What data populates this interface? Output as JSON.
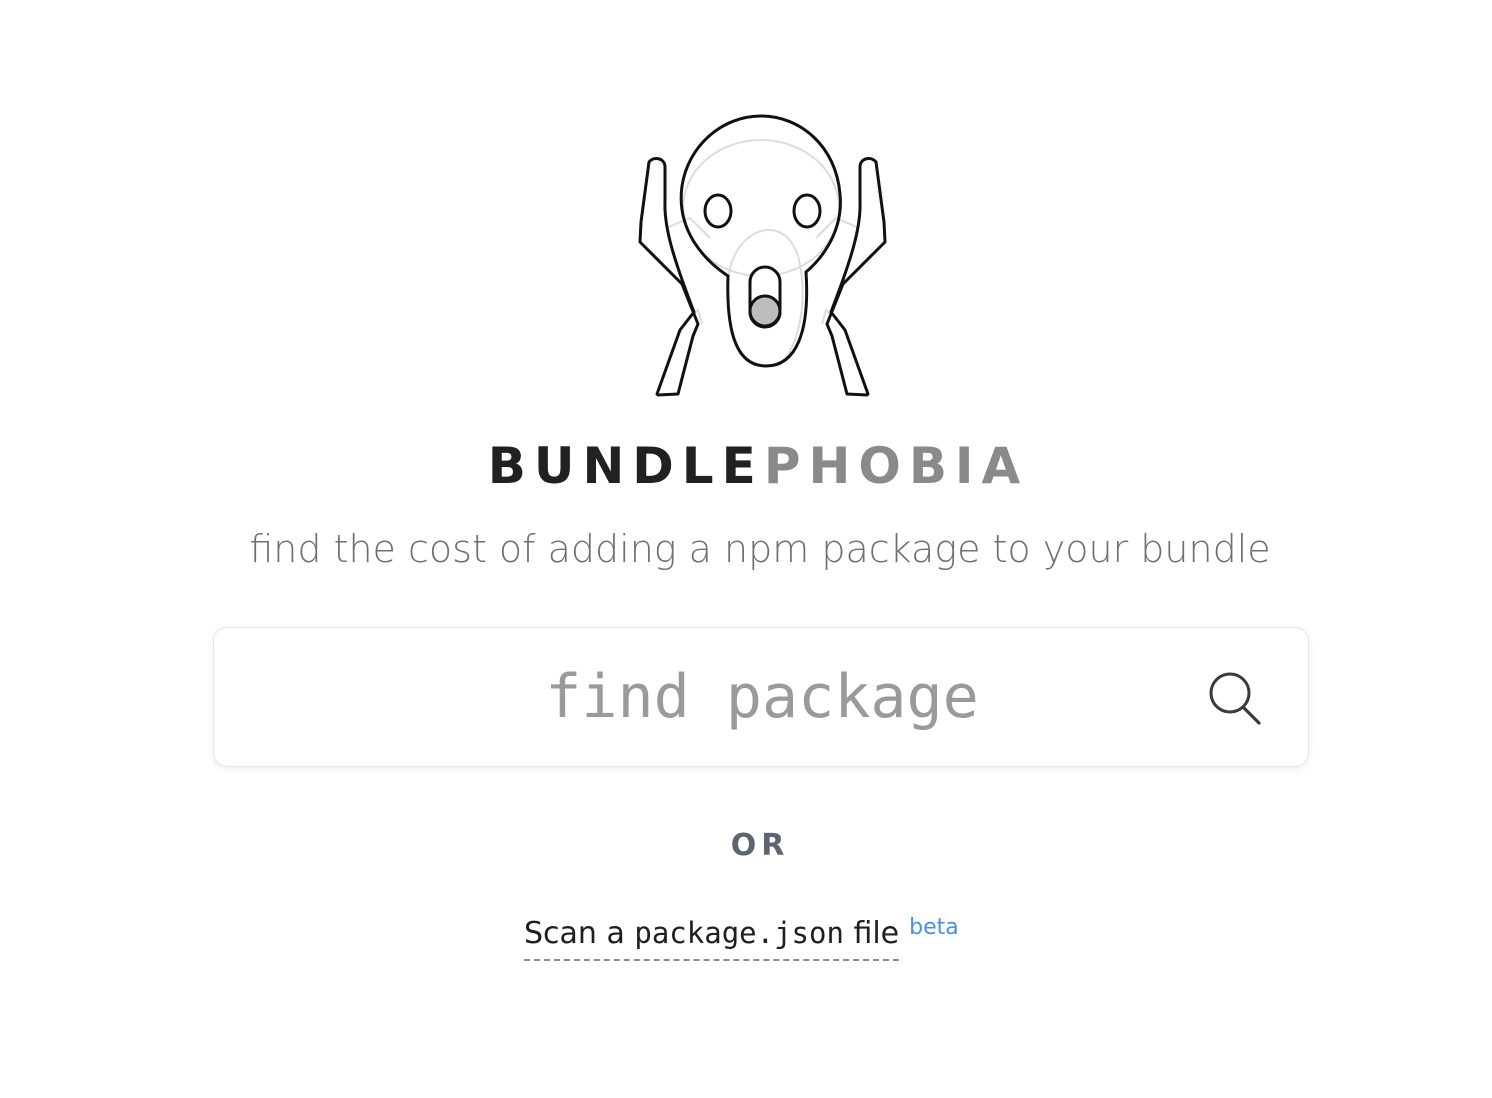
{
  "brand": {
    "name_dark": "BUNDLE",
    "name_light": "PHOBIA",
    "logo_icon": "screaming-face-logo-icon"
  },
  "tagline": "find the cost of adding a npm package to your bundle",
  "search": {
    "placeholder": "find package",
    "value": "",
    "icon": "search-icon"
  },
  "divider_text": "OR",
  "scan": {
    "prefix": "Scan a ",
    "code": "package.json",
    "suffix": " file",
    "badge": "beta"
  },
  "colors": {
    "brand_dark": "#212121",
    "brand_light": "#8a8a8a",
    "beta_blue": "#4a90e2",
    "or_text": "#5e6570"
  }
}
